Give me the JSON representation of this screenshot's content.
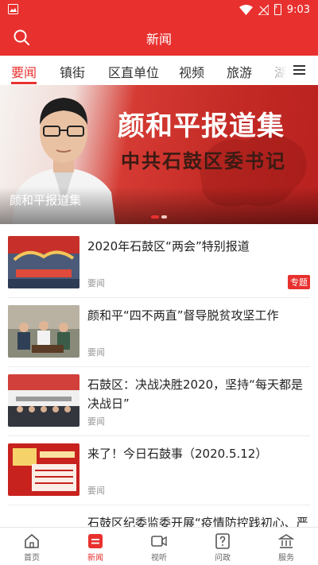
{
  "status_bar": {
    "time": "9:03",
    "battery_glyph": "⚡"
  },
  "header": {
    "title": "新闻"
  },
  "tabs": [
    {
      "label": "要闻",
      "active": true
    },
    {
      "label": "镇街"
    },
    {
      "label": "区直单位"
    },
    {
      "label": "视频"
    },
    {
      "label": "旅游"
    },
    {
      "label": "湖南"
    }
  ],
  "banner": {
    "headline": "颜和平报道集",
    "subline": "中共石鼓区委书记",
    "caption": "颜和平报道集",
    "slide_count": 2,
    "active_slide": 1
  },
  "news": [
    {
      "title": "2020年石鼓区“两会”特别报道",
      "source": "要闻",
      "badge": "专题"
    },
    {
      "title": "颜和平“四不两直”督导脱贫攻坚工作",
      "source": "要闻"
    },
    {
      "title": "石鼓区：决战决胜2020，坚持“每天都是决战日”",
      "source": "要闻"
    },
    {
      "title": "来了！今日石鼓事（2020.5.12）",
      "source": "要闻"
    },
    {
      "title": "石鼓区纪委监委开展“疫情防控践初心、严",
      "source": ""
    }
  ],
  "bottom_nav": [
    {
      "label": "首页",
      "icon": "home-icon"
    },
    {
      "label": "新闻",
      "icon": "news-icon",
      "active": true
    },
    {
      "label": "视听",
      "icon": "video-icon"
    },
    {
      "label": "问政",
      "icon": "question-icon"
    },
    {
      "label": "服务",
      "icon": "service-icon"
    }
  ],
  "colors": {
    "brand": "#e8312f",
    "text": "#222222",
    "muted": "#999999"
  }
}
